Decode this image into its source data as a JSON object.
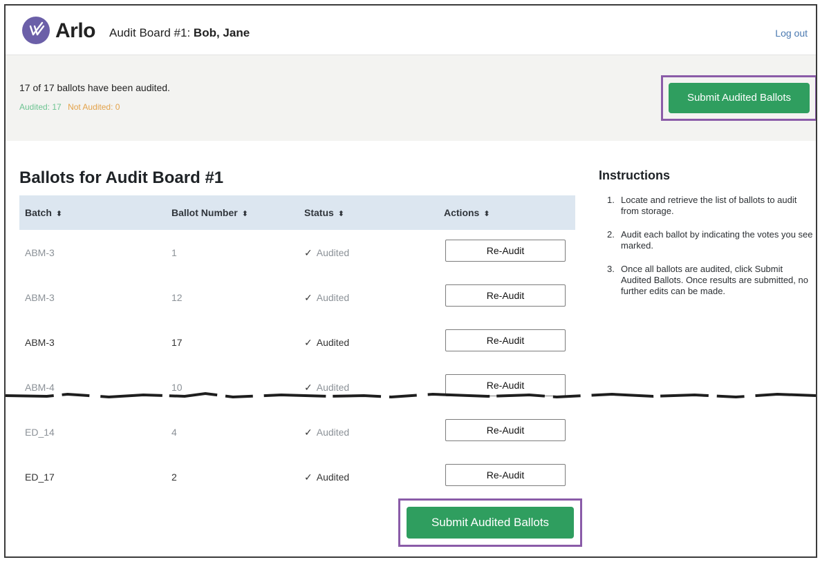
{
  "header": {
    "brand": "Arlo",
    "board_prefix": "Audit Board #1: ",
    "board_members": "Bob, Jane",
    "logout": "Log out"
  },
  "progress": {
    "summary": "17 of 17 ballots have been audited.",
    "audited_label": "Audited: 17",
    "not_audited_label": "Not Audited: 0",
    "submit_label": "Submit Audited Ballots"
  },
  "ballots": {
    "title": "Ballots for Audit Board #1",
    "columns": [
      "Batch",
      "Ballot Number",
      "Status",
      "Actions"
    ],
    "rows": [
      {
        "batch": "ABM-3",
        "ballot": "1",
        "status": "Audited",
        "action": "Re-Audit"
      },
      {
        "batch": "ABM-3",
        "ballot": "12",
        "status": "Audited",
        "action": "Re-Audit"
      },
      {
        "batch": "ABM-3",
        "ballot": "17",
        "status": "Audited",
        "action": "Re-Audit"
      },
      {
        "batch": "ABM-4",
        "ballot": "10",
        "status": "Audited",
        "action": "Re-Audit"
      },
      {
        "batch": "ED_14",
        "ballot": "4",
        "status": "Audited",
        "action": "Re-Audit"
      },
      {
        "batch": "ED_17",
        "ballot": "2",
        "status": "Audited",
        "action": "Re-Audit"
      }
    ],
    "submit_label": "Submit Audited Ballots"
  },
  "instructions": {
    "title": "Instructions",
    "steps": [
      {
        "num": "1.",
        "text": "Locate and retrieve the list of ballots to audit from storage."
      },
      {
        "num": "2.",
        "text": "Audit each ballot by indicating the votes you see marked."
      },
      {
        "num": "3.",
        "text": "Once all ballots are audited, click Submit Audited Ballots. Once results are submitted, no further edits can be made."
      }
    ]
  },
  "icons": {
    "logo": "arlo-logo-icon",
    "sort": "sort-icon",
    "check": "check-icon"
  },
  "colors": {
    "brand_purple": "#6b5fa8",
    "submit_green": "#2f9e5f",
    "highlight_purple": "#8a5ba8",
    "audited_green": "#6cc391",
    "not_audited_orange": "#e3a24a",
    "table_header": "#dce6f0"
  }
}
